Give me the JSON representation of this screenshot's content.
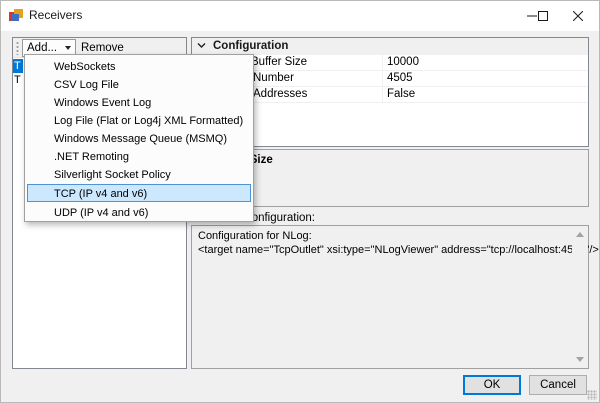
{
  "window": {
    "title": "Receivers",
    "controls": {
      "minimize": "minimize-icon",
      "maximize": "maximize-icon",
      "close": "close-icon"
    }
  },
  "toolbar": {
    "add_label": "Add...",
    "remove_label": "Remove"
  },
  "receivers_list": {
    "items": [
      {
        "label": "T",
        "selected": true
      },
      {
        "label": "T",
        "selected": false
      }
    ]
  },
  "property_grid": {
    "category": "Configuration",
    "rows": [
      {
        "name": "Buffer Size",
        "value": "10000"
      },
      {
        "name": "Number",
        "value": "4505"
      },
      {
        "name": "Addresses",
        "value": "False"
      }
    ]
  },
  "description": {
    "title": "ffer Size"
  },
  "config": {
    "label": "t Configuration:",
    "lines": [
      "Configuration for NLog:",
      "<target name=\"TcpOutlet\" xsi:type=\"NLogViewer\" address=\"tcp://localhost:4505\"/>"
    ]
  },
  "add_menu": {
    "items": [
      "WebSockets",
      "CSV Log File",
      "Windows Event Log",
      "Log File (Flat or Log4j XML Formatted)",
      "Windows Message Queue (MSMQ)",
      ".NET Remoting",
      "Silverlight Socket Policy",
      "TCP (IP v4 and v6)",
      "UDP (IP v4 and v6)"
    ],
    "highlighted": "TCP (IP v4 and v6)"
  },
  "buttons": {
    "ok": "OK",
    "cancel": "Cancel"
  },
  "colors": {
    "selection": "#0078d7",
    "menu_highlight": "#cce8ff",
    "menu_highlight_border": "#4f93d4",
    "chrome": "#f0f0f0"
  }
}
